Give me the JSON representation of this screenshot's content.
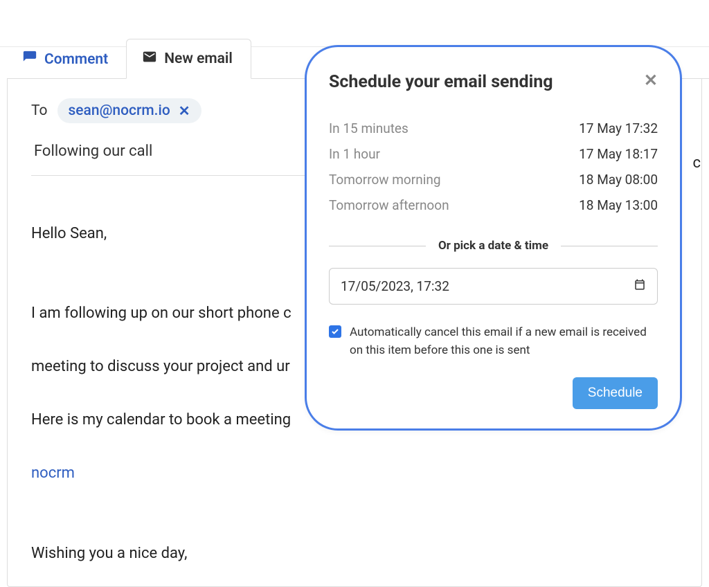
{
  "tabs": {
    "comment_label": "Comment",
    "new_email_label": "New email"
  },
  "compose": {
    "to_label": "To",
    "recipient": "sean@nocrm.io",
    "subject": "Following our call",
    "body_line1": "Hello Sean,",
    "body_line2": "I am following up on our short phone c",
    "body_line3": "meeting to discuss your project and ur",
    "body_line4": "Here is my calendar to book a meeting",
    "body_link": "nocrm",
    "body_line5": "Wishing you a nice day,"
  },
  "popover": {
    "title": "Schedule your email sending",
    "presets": [
      {
        "label": "In 15 minutes",
        "time": "17 May 17:32"
      },
      {
        "label": "In 1 hour",
        "time": "17 May 18:17"
      },
      {
        "label": "Tomorrow morning",
        "time": "18 May 08:00"
      },
      {
        "label": "Tomorrow afternoon",
        "time": "18 May 13:00"
      }
    ],
    "divider_text": "Or pick a date & time",
    "datetime_value": "17/05/2023, 17:32",
    "auto_cancel_text": "Automatically cancel this email if a new email is received on this item before this one is sent",
    "auto_cancel_checked": true,
    "schedule_button": "Schedule"
  },
  "stray": {
    "c": "c"
  }
}
